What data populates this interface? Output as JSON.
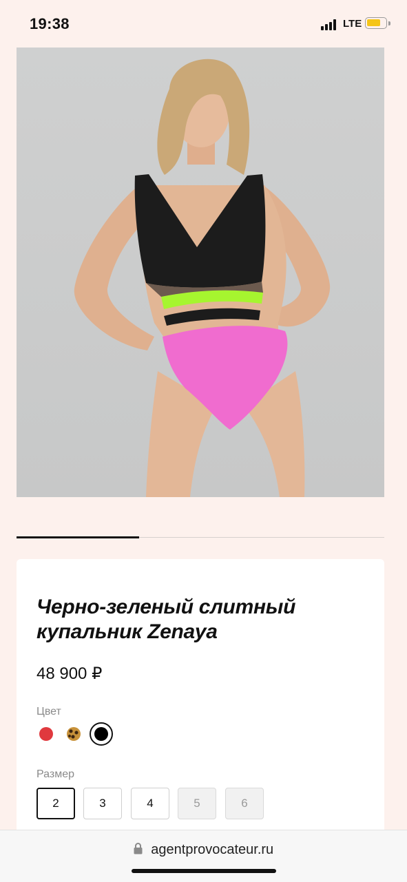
{
  "status_bar": {
    "time": "19:38",
    "network": "LTE",
    "battery_level": 0.75,
    "battery_color": "#f5c518"
  },
  "product": {
    "image_icon": "product-photo",
    "title": "Черно-зеленый слитный купальник Zenaya",
    "price": "48 900 ₽",
    "carousel_progress": 0.333,
    "color_label": "Цвет",
    "colors": [
      {
        "name": "red",
        "hex": "#e0393e",
        "selected": false
      },
      {
        "name": "leopard",
        "hex": "#c8923a",
        "selected": false
      },
      {
        "name": "black",
        "hex": "#000000",
        "selected": true
      }
    ],
    "size_label": "Размер",
    "sizes": [
      {
        "label": "2",
        "selected": true,
        "available": true
      },
      {
        "label": "3",
        "selected": false,
        "available": true
      },
      {
        "label": "4",
        "selected": false,
        "available": true
      },
      {
        "label": "5",
        "selected": false,
        "available": false
      },
      {
        "label": "6",
        "selected": false,
        "available": false
      }
    ]
  },
  "browser": {
    "url": "agentprovocateur.ru",
    "lock_icon": "lock-icon"
  }
}
